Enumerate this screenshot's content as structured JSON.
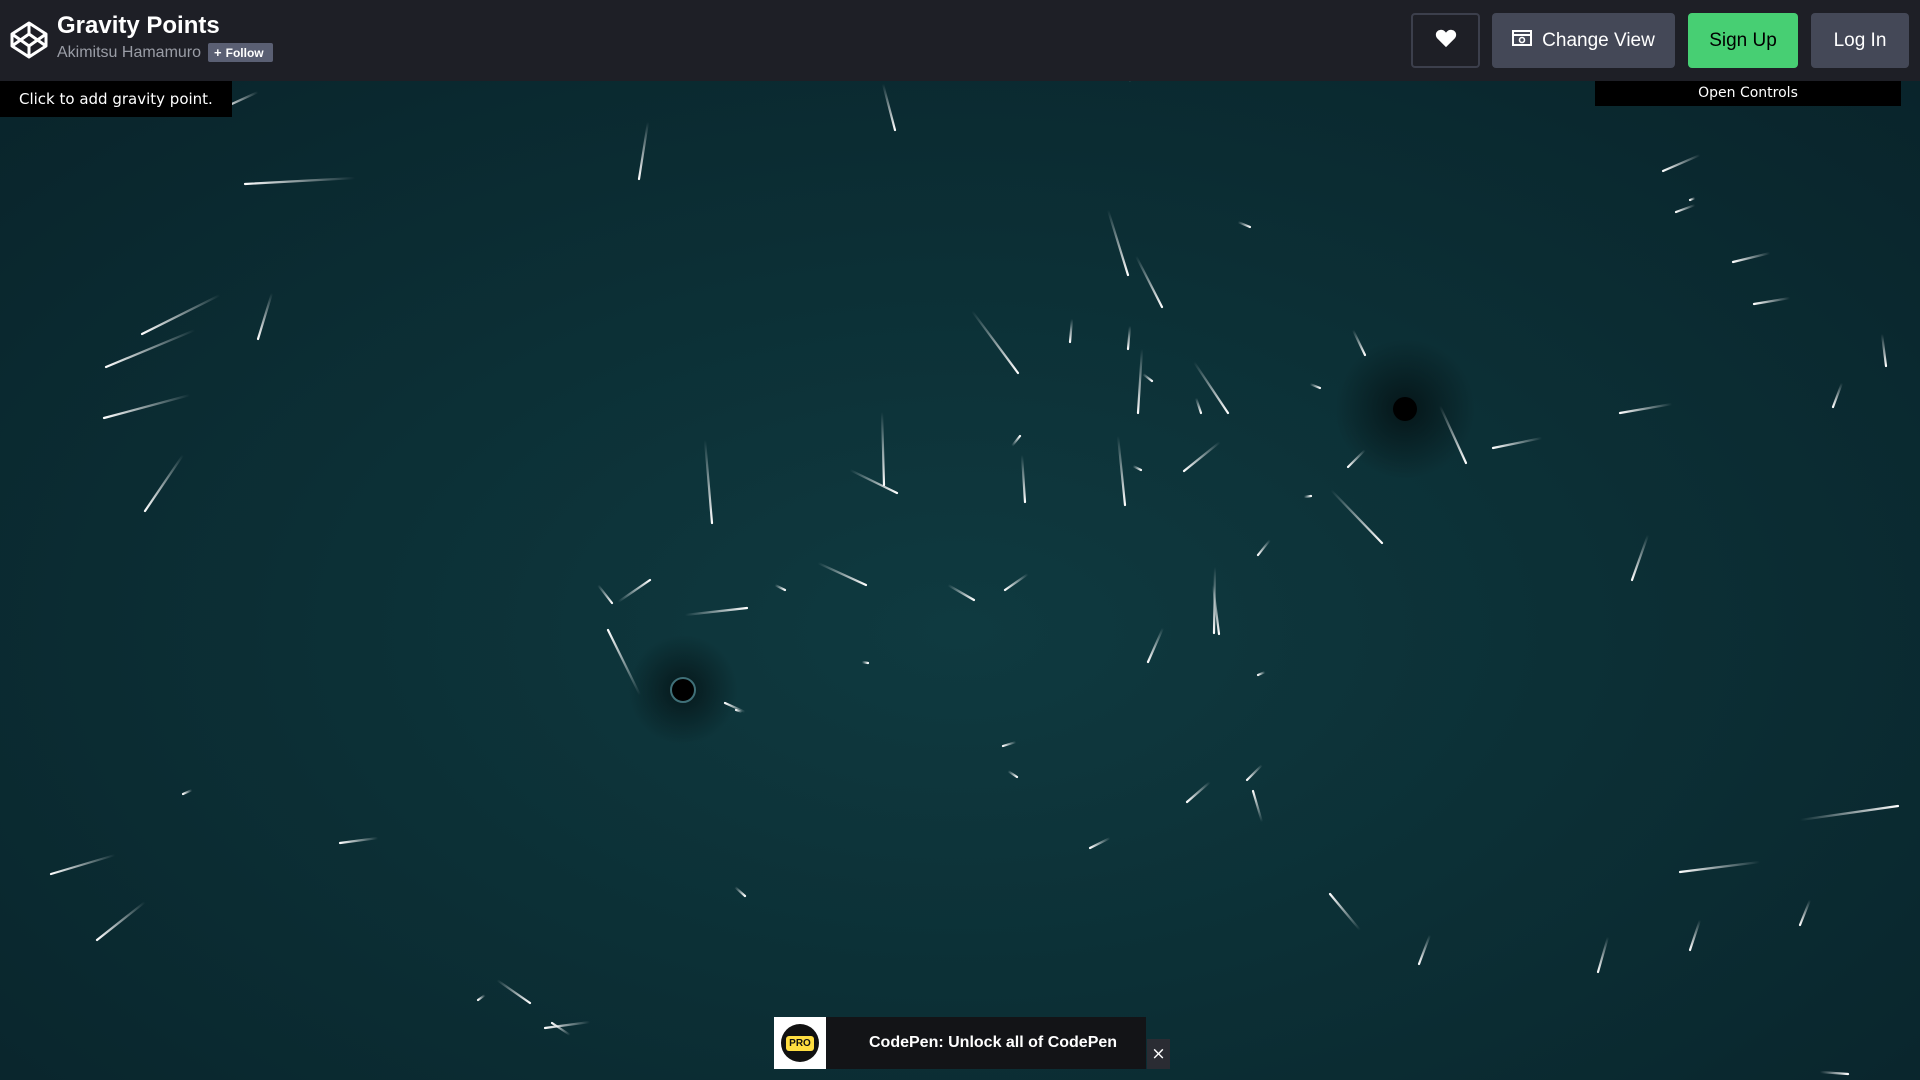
{
  "header": {
    "pen_title": "Gravity Points",
    "author": "Akimitsu Hamamuro",
    "follow_label": "Follow",
    "buttons": {
      "heart_icon": "heart-icon",
      "change_view_label": "Change View",
      "sign_up_label": "Sign Up",
      "log_in_label": "Log In"
    }
  },
  "canvas": {
    "info_text": "Click to add gravity point.",
    "controls_label": "Open Controls",
    "gravity_point_count": 2
  },
  "promo": {
    "badge_text": "PRO",
    "text": "CodePen: Unlock all of CodePen",
    "close_icon": "×"
  },
  "colors": {
    "header_bg": "#1e1f26",
    "stage_bg": "#0c2a31",
    "sign_up_bg": "#47cf73",
    "button_bg": "#444857",
    "particle": "#ffffff"
  }
}
